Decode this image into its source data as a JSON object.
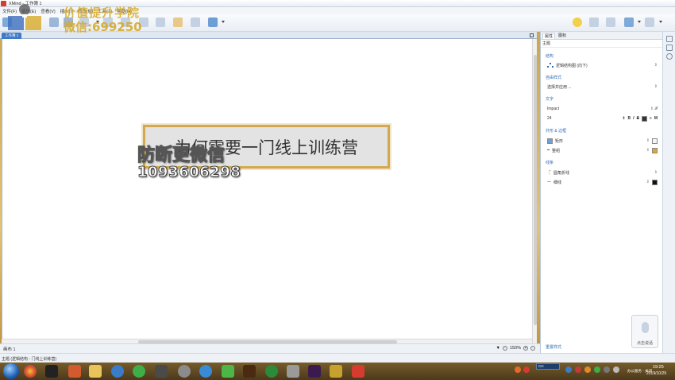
{
  "window": {
    "title": "XMind - 工作簿 1"
  },
  "menu": [
    "文件(F)",
    "编辑(E)",
    "查看(V)",
    "插入(I)",
    "修改(M)",
    "工具(T)",
    "帮助(H)"
  ],
  "watermark": {
    "brand": "价值提升学院",
    "wechat": "微信:699250",
    "anti": "防断更微信",
    "number": "1093606298"
  },
  "editor": {
    "tab_label": "工作簿 1",
    "topic_text": "为何需要一门线上训练营",
    "sheet_tab": "画布 1",
    "zoom": "150%"
  },
  "panel": {
    "tabs": [
      "属性",
      "图标"
    ],
    "subtitle": "主题",
    "sections": {
      "structure": "结构",
      "structure_value": "逻辑结构图 (向下)",
      "theme_style": "自由样式",
      "theme_value": "选择并应用 ...",
      "text": "文字",
      "font_family": "Impact",
      "font_size": "24",
      "shape_border": "外形 & 边框",
      "shape_value": "矩形",
      "border_value": "整组",
      "lines": "线条",
      "line_shape": "圆角折线",
      "line_width": "细线",
      "footer_link": "重置样式"
    },
    "font_tools": [
      "B",
      "I",
      "S",
      "M"
    ],
    "colors": {
      "fill": "#f5f5f5",
      "border": "#e0a830",
      "line": "#111111",
      "text": "#333333"
    }
  },
  "voice_widget": {
    "label": "点击说话"
  },
  "status": {
    "text": "主题 (逻辑结构 - 门线上训练营)"
  },
  "taskbar": {
    "lang": "CH",
    "notice": "办公服务 - 关闭",
    "time": "19:25",
    "date": "2019/10/29"
  }
}
